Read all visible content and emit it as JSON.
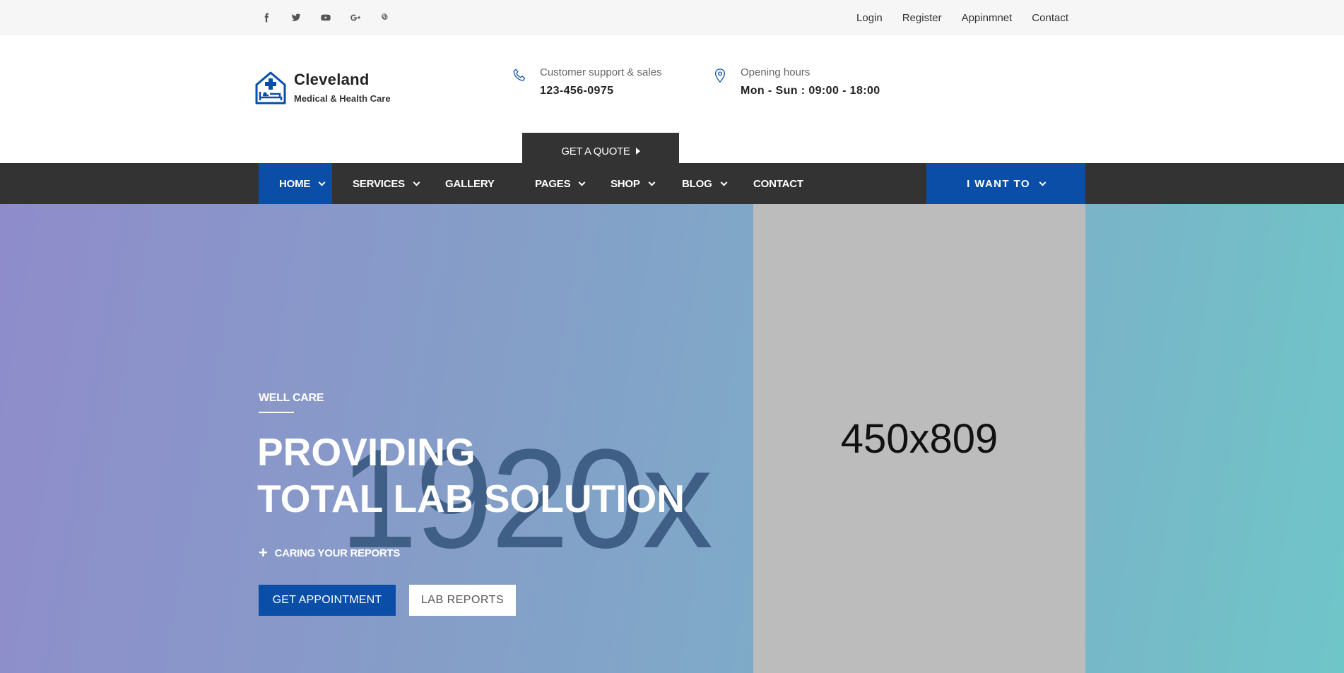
{
  "topbar": {
    "social": [
      "facebook-icon",
      "twitter-icon",
      "youtube-icon",
      "google-plus-icon",
      "pinterest-icon"
    ],
    "links": [
      "Login",
      "Register",
      "Appinmnet",
      "Contact"
    ]
  },
  "brand": {
    "title": "Cleveland",
    "subtitle": "Medical & Health Care",
    "accent": "#0a4ea8"
  },
  "contact": {
    "support_label": "Customer support & sales",
    "support_value": "123-456-0975",
    "hours_label": "Opening hours",
    "hours_value": "Mon - Sun : 09:00 - 18:00"
  },
  "quote_button": "GET A QUOTE",
  "nav": {
    "items": [
      {
        "label": "HOME",
        "dropdown": true,
        "active": true
      },
      {
        "label": "SERVICES",
        "dropdown": true
      },
      {
        "label": "GALLERY",
        "dropdown": false
      },
      {
        "label": "PAGES",
        "dropdown": true
      },
      {
        "label": "SHOP",
        "dropdown": true
      },
      {
        "label": "BLOG",
        "dropdown": true
      },
      {
        "label": "CONTACT",
        "dropdown": false
      }
    ],
    "cta": "I WANT TO"
  },
  "hero": {
    "background_text": "1920x",
    "placeholder_text": "450x809",
    "eyebrow": "WELL CARE",
    "headline_line1": "PROVIDING",
    "headline_line2": "TOTAL LAB SOLUTION",
    "tagline": "CARING YOUR REPORTS",
    "primary_button": "GET APPOINTMENT",
    "secondary_button": "LAB REPORTS"
  }
}
